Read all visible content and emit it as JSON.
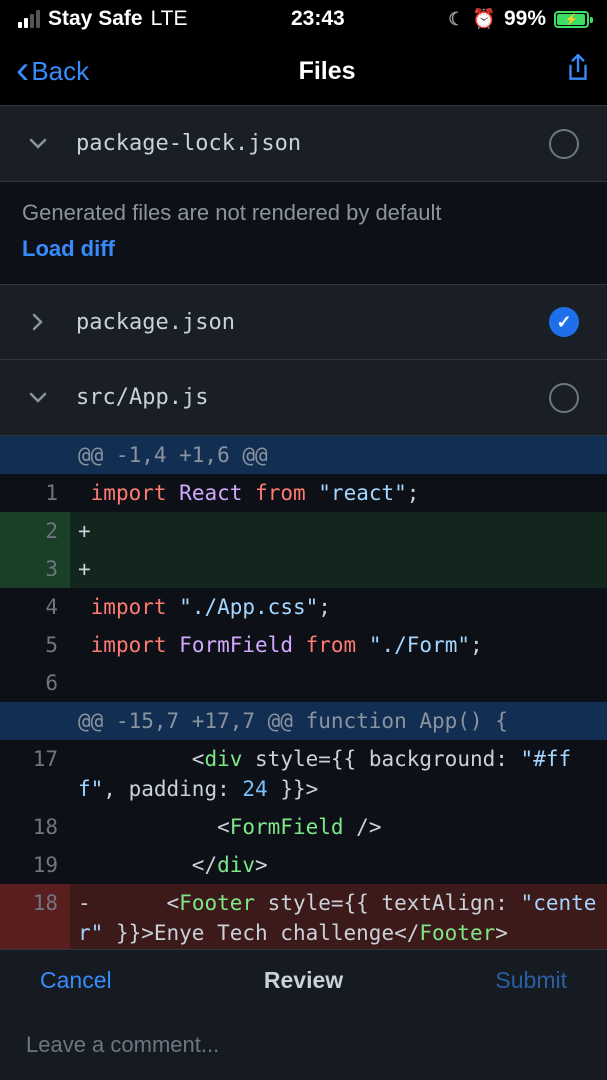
{
  "status": {
    "carrier": "Stay Safe",
    "network": "LTE",
    "time": "23:43",
    "battery_pct": "99%"
  },
  "nav": {
    "back_label": "Back",
    "title": "Files"
  },
  "files": [
    {
      "name": "package-lock.json",
      "expanded": true,
      "checked": false
    },
    {
      "name": "package.json",
      "expanded": false,
      "checked": true
    },
    {
      "name": "src/App.js",
      "expanded": true,
      "checked": false
    }
  ],
  "notice": {
    "text": "Generated files are not rendered by default",
    "link": "Load diff"
  },
  "diff": {
    "hunk1": "@@ -1,4 +1,6 @@",
    "hunk2": "@@ -15,7 +17,7 @@ function App() {",
    "ln1": "1",
    "ln2": "2",
    "ln3": "3",
    "ln4": "4",
    "ln5": "5",
    "ln6": "6",
    "ln17": "17",
    "ln18": "18",
    "ln19": "19",
    "ln18b": "18",
    "plus": "+",
    "minus": "-",
    "code": {
      "import": "import",
      "react_name": "React",
      "from": "from",
      "react_str": "\"react\"",
      "semi": ";",
      "appcss": "\"./App.css\"",
      "formfield": "FormField",
      "form_str": "\"./Form\"",
      "div_open_pre": "         <",
      "div": "div",
      "style_attr": " style={{ background: ",
      "fff": "\"#fff\"",
      "pad": ", padding: ",
      "n24": "24",
      "close_obj": " }}>",
      "ff_pre": "           <",
      "ff_close": " />",
      "divclose_pre": "         </",
      "gt": ">",
      "footer_pre": "      <",
      "footer": "Footer",
      "style2": " style={{ textAlign: ",
      "center": "\"center\"",
      "enye": " }}>Enye Tech challenge</",
      "footer_end": ">"
    }
  },
  "actions": {
    "cancel": "Cancel",
    "review": "Review",
    "submit": "Submit",
    "comment_placeholder": "Leave a comment..."
  }
}
